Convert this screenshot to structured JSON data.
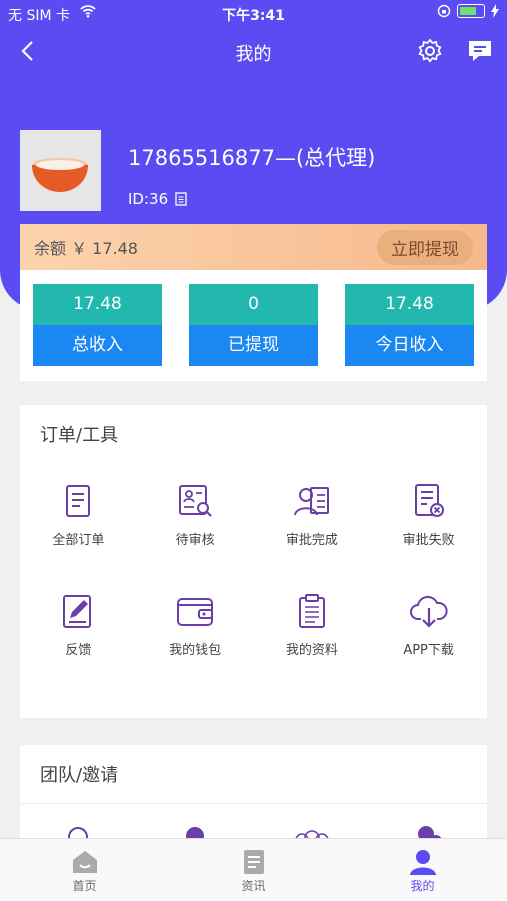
{
  "status": {
    "carrier": "无 SIM 卡",
    "time": "下午3:41"
  },
  "nav": {
    "title": "我的"
  },
  "profile": {
    "phone": "17865516877—(总代理)",
    "id": "ID:36"
  },
  "balance": {
    "label": "余额 ￥ 17.48",
    "button": "立即提现"
  },
  "stats": [
    {
      "value": "17.48",
      "label": "总收入"
    },
    {
      "value": "0",
      "label": "已提现"
    },
    {
      "value": "17.48",
      "label": "今日收入"
    }
  ],
  "orders": {
    "title": "订单/工具",
    "items": [
      {
        "label": "全部订单",
        "icon": "document-icon"
      },
      {
        "label": "待审核",
        "icon": "id-card-search-icon"
      },
      {
        "label": "审批完成",
        "icon": "user-list-icon"
      },
      {
        "label": "审批失败",
        "icon": "document-x-icon"
      },
      {
        "label": "反馈",
        "icon": "edit-note-icon"
      },
      {
        "label": "我的钱包",
        "icon": "wallet-icon"
      },
      {
        "label": "我的资料",
        "icon": "clipboard-icon"
      },
      {
        "label": "APP下载",
        "icon": "cloud-download-icon"
      }
    ]
  },
  "team": {
    "title": "团队/邀请"
  },
  "tabbar": [
    {
      "label": "首页",
      "icon": "home-icon"
    },
    {
      "label": "资讯",
      "icon": "news-icon"
    },
    {
      "label": "我的",
      "icon": "profile-icon"
    }
  ],
  "colors": {
    "primary": "#5b4bf2",
    "teal": "#22b8b0",
    "blue": "#1b87f3",
    "icon": "#6a3fa8"
  }
}
